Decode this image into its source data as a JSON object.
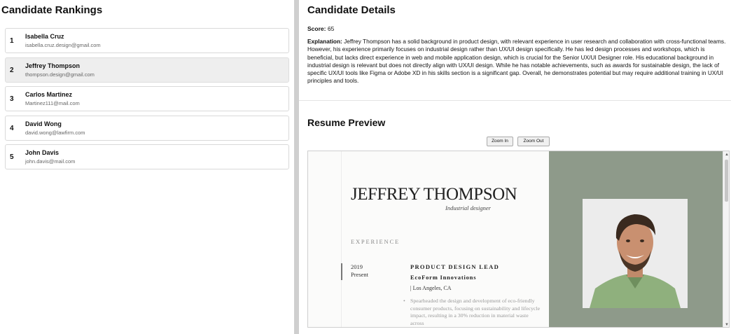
{
  "rankings": {
    "title": "Candidate Rankings",
    "candidates": [
      {
        "rank": "1",
        "name": "Isabella Cruz",
        "email": "isabella.cruz.design@gmail.com",
        "selected": false
      },
      {
        "rank": "2",
        "name": "Jeffrey Thompson",
        "email": "thompson.design@gmail.com",
        "selected": true
      },
      {
        "rank": "3",
        "name": "Carlos Martinez",
        "email": "Martinez111@mail.com",
        "selected": false
      },
      {
        "rank": "4",
        "name": "David Wong",
        "email": "david.wong@lawfirm.com",
        "selected": false
      },
      {
        "rank": "5",
        "name": "John Davis",
        "email": "john.davis@mail.com",
        "selected": false
      }
    ]
  },
  "details": {
    "title": "Candidate Details",
    "score_label": "Score:",
    "score_value": "65",
    "explanation_label": "Explanation:",
    "explanation_text": "Jeffrey Thompson has a solid background in product design, with relevant experience in user research and collaboration with cross-functional teams. However, his experience primarily focuses on industrial design rather than UX/UI design specifically. He has led design processes and workshops, which is beneficial, but lacks direct experience in web and mobile application design, which is crucial for the Senior UX/UI Designer role. His educational background in industrial design is relevant but does not directly align with UX/UI design. While he has notable achievements, such as awards for sustainable design, the lack of specific UX/UI tools like Figma or Adobe XD in his skills section is a significant gap. Overall, he demonstrates potential but may require additional training in UX/UI principles and tools."
  },
  "preview": {
    "title": "Resume Preview",
    "zoom_in_label": "Zoom In",
    "zoom_out_label": "Zoom Out",
    "resume": {
      "name": "JEFFREY THOMPSON",
      "role": "Industrial designer",
      "section": "EXPERIENCE",
      "year_start": "2019",
      "year_end": "Present",
      "job_title": "PRODUCT DESIGN LEAD",
      "company": "EcoForm Innovations",
      "location": "| Los Angeles, CA",
      "bullet": "Spearheaded the design and development of eco-friendly consumer products, focusing on sustainability and lifecycle impact, resulting in a 30% reduction in material waste across"
    }
  },
  "colors": {
    "selected_bg": "#eeeeee",
    "splitter": "#cfcfcf",
    "resume_side": "#8e9a8a",
    "shirt": "#8fb07d"
  }
}
